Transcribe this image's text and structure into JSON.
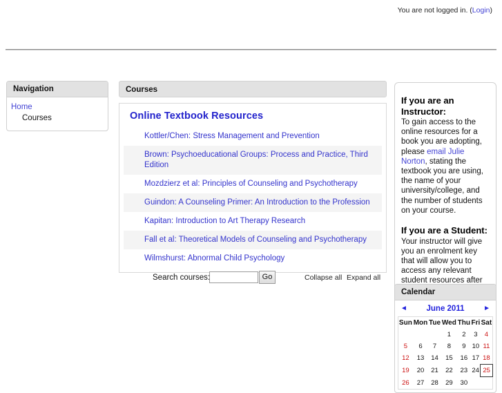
{
  "header": {
    "login_notice": "You are not logged in. (",
    "login_link": "Login",
    "login_notice_end": ")"
  },
  "navigation": {
    "title": "Navigation",
    "items": [
      {
        "label": "Home",
        "is_link": true
      },
      {
        "label": "Courses",
        "is_link": false
      }
    ]
  },
  "main": {
    "panel_title": "Courses",
    "category_title": "Online Textbook Resources",
    "courses": [
      {
        "name": "Kottler/Chen: Stress Management and Prevention"
      },
      {
        "name": "Brown: Psychoeducational Groups: Process and Practice, Third Edition"
      },
      {
        "name": "Mozdzierz et al: Principles of Counseling and Psychotherapy"
      },
      {
        "name": "Guindon: A Counseling Primer: An Introduction to the Profession"
      },
      {
        "name": "Kapitan: Introduction to Art Therapy Research"
      },
      {
        "name": "Fall et al: Theoretical Models of Counseling and Psychotherapy"
      },
      {
        "name": "Wilmshurst: Abnormal Child Psychology"
      }
    ],
    "search_label": "Search courses:",
    "search_value": "",
    "search_placeholder": "",
    "go_label": "Go",
    "collapse_all": "Collapse all",
    "expand_all": "Expand all"
  },
  "info_block": {
    "instructor_heading": "If you are an Instructor:",
    "instructor_text_1": "To gain access to the online resources for a book you are adopting, please ",
    "instructor_email_link": "email Julie Norton",
    "instructor_text_2": ", stating the textbook you are using, the name of your university/college, and the number of students on your course.",
    "student_heading": "If you are a Student:",
    "student_text": "Your instructor will give you an enrolment key that will allow you to access any relevant student resources after you have created an account."
  },
  "calendar": {
    "title": "Calendar",
    "prev_arrow": "◄",
    "next_arrow": "►",
    "month_label": "June 2011",
    "weekday_headers": [
      "Sun",
      "Mon",
      "Tue",
      "Wed",
      "Thu",
      "Fri",
      "Sat"
    ],
    "weeks": [
      [
        {
          "d": "",
          "w": true
        },
        {
          "d": ""
        },
        {
          "d": ""
        },
        {
          "d": "1"
        },
        {
          "d": "2"
        },
        {
          "d": "3"
        },
        {
          "d": "4",
          "w": true
        }
      ],
      [
        {
          "d": "5",
          "w": true
        },
        {
          "d": "6"
        },
        {
          "d": "7"
        },
        {
          "d": "8"
        },
        {
          "d": "9"
        },
        {
          "d": "10"
        },
        {
          "d": "11",
          "w": true
        }
      ],
      [
        {
          "d": "12",
          "w": true
        },
        {
          "d": "13"
        },
        {
          "d": "14"
        },
        {
          "d": "15"
        },
        {
          "d": "16"
        },
        {
          "d": "17"
        },
        {
          "d": "18",
          "w": true
        }
      ],
      [
        {
          "d": "19",
          "w": true
        },
        {
          "d": "20"
        },
        {
          "d": "21"
        },
        {
          "d": "22"
        },
        {
          "d": "23"
        },
        {
          "d": "24"
        },
        {
          "d": "25",
          "w": true,
          "today": true
        }
      ],
      [
        {
          "d": "26",
          "w": true
        },
        {
          "d": "27"
        },
        {
          "d": "28"
        },
        {
          "d": "29"
        },
        {
          "d": "30"
        },
        {
          "d": ""
        },
        {
          "d": "",
          "w": true
        }
      ]
    ]
  },
  "colors": {
    "link": "#4242d4",
    "course_link": "#3333cc",
    "category_title": "#2222cc",
    "block_header_bg": "#e2e2e2",
    "weekend": "#cc1111",
    "alt_row": "#f4f4f4"
  }
}
